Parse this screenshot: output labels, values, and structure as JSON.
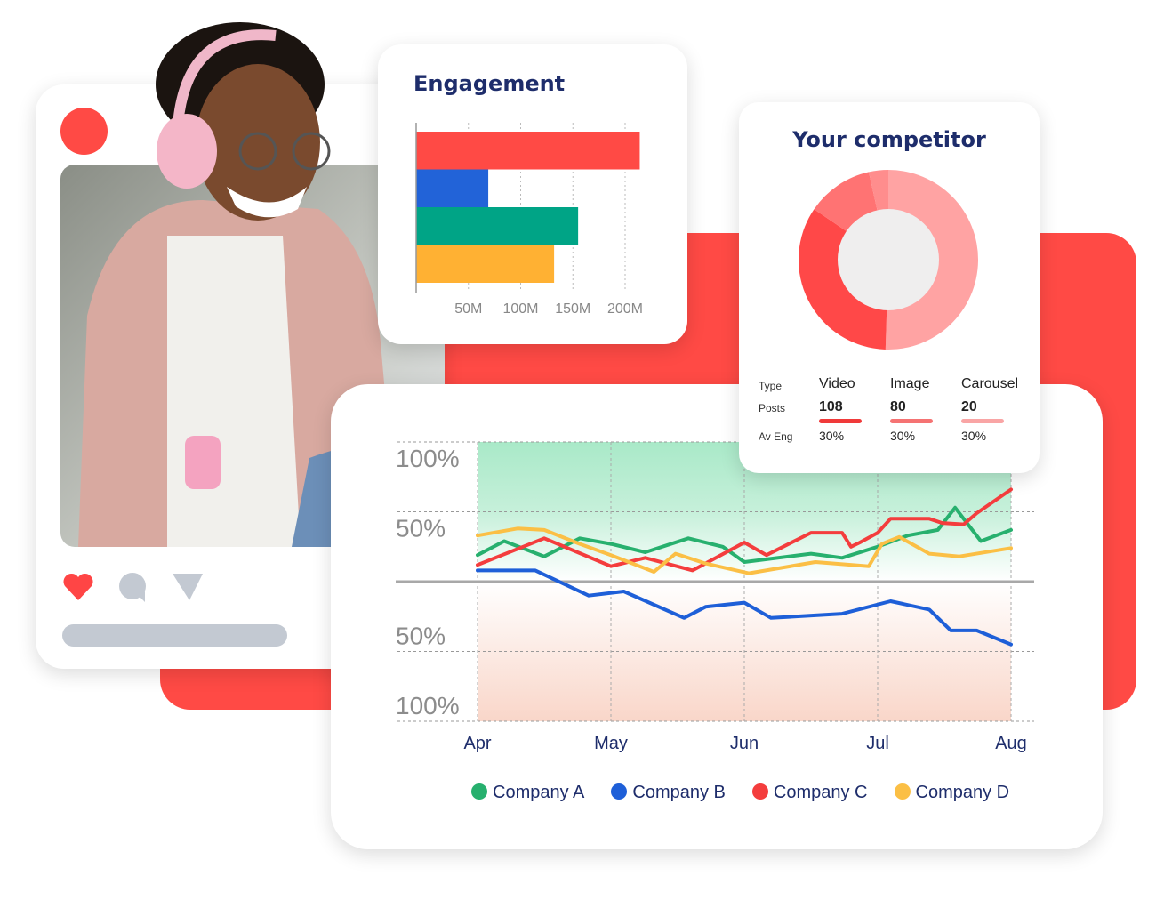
{
  "colors": {
    "brand_red": "#ff4a45",
    "navy": "#1e2d6b",
    "placeholder_gray": "#c3c9d2"
  },
  "post_card": {
    "icons": [
      "heart-icon",
      "comment-icon",
      "send-icon"
    ],
    "heart_color": "#ff4545",
    "icon_gray": "#c3c9d2"
  },
  "engagement": {
    "title": "Engagement",
    "chart_data": {
      "type": "bar",
      "orientation": "horizontal",
      "categories": [
        "Company C",
        "Company B",
        "Company A",
        "Company D"
      ],
      "values": [
        214,
        69,
        155,
        132
      ],
      "colors": [
        "#ff4a45",
        "#2263d8",
        "#00a486",
        "#ffb133"
      ],
      "xticks": [
        "50M",
        "100M",
        "150M",
        "200M"
      ],
      "xtick_values": [
        50,
        100,
        150,
        200
      ],
      "xlim": [
        0,
        235
      ],
      "unit": "M",
      "grid": true
    }
  },
  "competitor": {
    "title": "Your competitor",
    "chart_data": {
      "type": "pie",
      "donut": true,
      "slices": [
        50.5,
        34,
        12,
        3.5
      ],
      "colors": [
        "#ffa3a3",
        "#ff4848",
        "#ff7373",
        "#ff8d8d"
      ]
    },
    "table": {
      "row_labels": [
        "Type",
        "Posts",
        "Av Eng"
      ],
      "columns": [
        {
          "type": "Video",
          "posts": "108",
          "av_eng": "30%",
          "color": "#f03a3a"
        },
        {
          "type": "Image",
          "posts": "80",
          "av_eng": "30%",
          "color": "#f57373"
        },
        {
          "type": "Carousel",
          "posts": "20",
          "av_eng": "30%",
          "color": "#f9a5a5"
        }
      ]
    }
  },
  "trend": {
    "chart_data": {
      "type": "line",
      "ylim": [
        -100,
        100
      ],
      "yticks": [
        "100%",
        "50%",
        "50%",
        "100%"
      ],
      "ytick_values": [
        100,
        50,
        -50,
        -100
      ],
      "xticks": [
        "Apr",
        "May",
        "Jun",
        "Jul",
        "Aug"
      ],
      "grid": true,
      "legend_placement": "bottom",
      "series": [
        {
          "name": "Company A",
          "color": "#27b06e",
          "points": [
            [
              "Apr 1",
              19
            ],
            [
              "Apr 7",
              29
            ],
            [
              "Apr 16",
              18
            ],
            [
              "Apr 24",
              31
            ],
            [
              "May 1",
              27
            ],
            [
              "May 9",
              21
            ],
            [
              "May 19",
              31
            ],
            [
              "May 27",
              25
            ],
            [
              "Jun 1",
              14
            ],
            [
              "Jun 16",
              20
            ],
            [
              "Jun 23",
              17
            ],
            [
              "Jul 1",
              25
            ],
            [
              "Jul 8",
              33
            ],
            [
              "Jul 15",
              37
            ],
            [
              "Jul 19",
              53
            ],
            [
              "Jul 25",
              29
            ],
            [
              "Aug 1",
              37
            ]
          ]
        },
        {
          "name": "Company B",
          "color": "#1e5fd8",
          "points": [
            [
              "Apr 1",
              8
            ],
            [
              "Apr 14",
              8
            ],
            [
              "Apr 26",
              -10
            ],
            [
              "May 4",
              -7
            ],
            [
              "May 18",
              -26
            ],
            [
              "May 23",
              -18
            ],
            [
              "Jun 1",
              -15
            ],
            [
              "Jun 7",
              -26
            ],
            [
              "Jun 23",
              -23
            ],
            [
              "Jul 4",
              -14
            ],
            [
              "Jul 13",
              -20
            ],
            [
              "Jul 18",
              -35
            ],
            [
              "Jul 24",
              -35
            ],
            [
              "Aug 1",
              -45
            ]
          ]
        },
        {
          "name": "Company C",
          "color": "#f43d3d",
          "points": [
            [
              "Apr 1",
              12
            ],
            [
              "Apr 16",
              31
            ],
            [
              "May 1",
              11
            ],
            [
              "May 9",
              17
            ],
            [
              "May 20",
              8
            ],
            [
              "Jun 1",
              28
            ],
            [
              "Jun 6",
              19
            ],
            [
              "Jun 16",
              35
            ],
            [
              "Jun 23",
              35
            ],
            [
              "Jun 25",
              25
            ],
            [
              "Jun 27",
              28
            ],
            [
              "Jul 1",
              35
            ],
            [
              "Jul 4",
              45
            ],
            [
              "Jul 13",
              45
            ],
            [
              "Jul 16",
              42
            ],
            [
              "Jul 21",
              41
            ],
            [
              "Jul 24",
              49
            ],
            [
              "Aug 1",
              66
            ]
          ]
        },
        {
          "name": "Company D",
          "color": "#fbbf45",
          "points": [
            [
              "Apr 1",
              33
            ],
            [
              "Apr 10",
              38
            ],
            [
              "Apr 16",
              37
            ],
            [
              "Apr 24",
              27
            ],
            [
              "May 1",
              19
            ],
            [
              "May 11",
              7
            ],
            [
              "May 16",
              20
            ],
            [
              "May 23",
              13
            ],
            [
              "Jun 2",
              6
            ],
            [
              "Jun 17",
              14
            ],
            [
              "Jun 29",
              11
            ],
            [
              "Jul 2",
              27
            ],
            [
              "Jul 6",
              32
            ],
            [
              "Jul 13",
              20
            ],
            [
              "Jul 20",
              18
            ],
            [
              "Aug 1",
              24
            ]
          ]
        }
      ]
    }
  }
}
